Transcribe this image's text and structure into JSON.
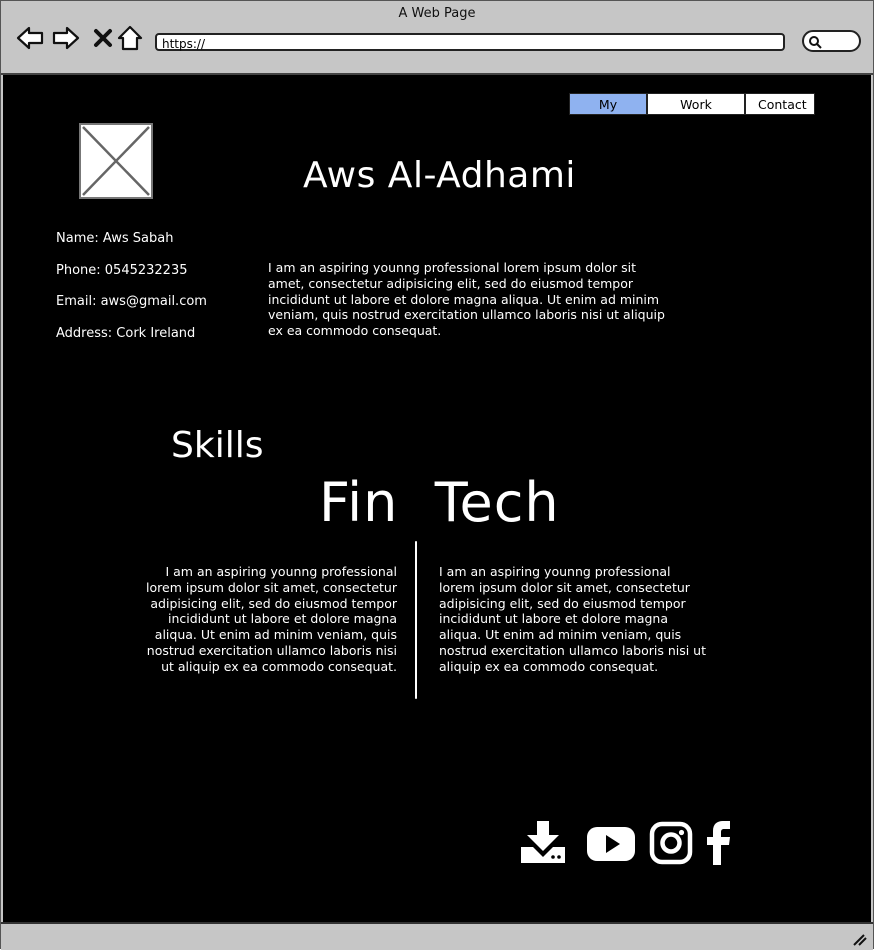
{
  "window": {
    "title": "A Web Page"
  },
  "address_bar": {
    "url": "https://"
  },
  "nav": {
    "tabs": [
      {
        "label": "My Story",
        "active": true
      },
      {
        "label": "Work history",
        "active": false
      },
      {
        "label": "Contact",
        "active": false
      }
    ]
  },
  "header": {
    "name": "Aws Al-Adhami"
  },
  "info": {
    "name": "Name: Aws Sabah",
    "phone": "Phone: 0545232235",
    "email": "Email: aws@gmail.com",
    "address": "Address: Cork Ireland"
  },
  "bio": "I am an aspiring younng professional lorem ipsum dolor sit amet, consectetur adipisicing elit, sed do eiusmod tempor incididunt ut labore et dolore magna aliqua. Ut enim ad minim veniam, quis nostrud exercitation ullamco laboris nisi ut aliquip ex ea commodo consequat.",
  "skills": {
    "heading": "Skills",
    "title": "Fin  Tech",
    "left_text": "I am an aspiring younng professional lorem ipsum dolor sit amet, consectetur adipisicing elit, sed do eiusmod tempor incididunt ut labore et dolore magna aliqua. Ut enim ad minim veniam, quis nostrud exercitation ullamco laboris nisi ut aliquip ex ea commodo consequat.",
    "right_text": "I am an aspiring younng professional lorem ipsum dolor sit amet, consectetur adipisicing elit, sed do eiusmod tempor incididunt ut labore et dolore magna aliqua. Ut enim ad minim veniam, quis nostrud exercitation ullamco laboris nisi ut aliquip ex ea commodo consequat."
  },
  "social": [
    "download-icon",
    "youtube-icon",
    "instagram-icon",
    "facebook-icon"
  ],
  "colors": {
    "active_tab": "#8fb2f0",
    "background": "#000000",
    "chrome": "#c6c6c6"
  }
}
